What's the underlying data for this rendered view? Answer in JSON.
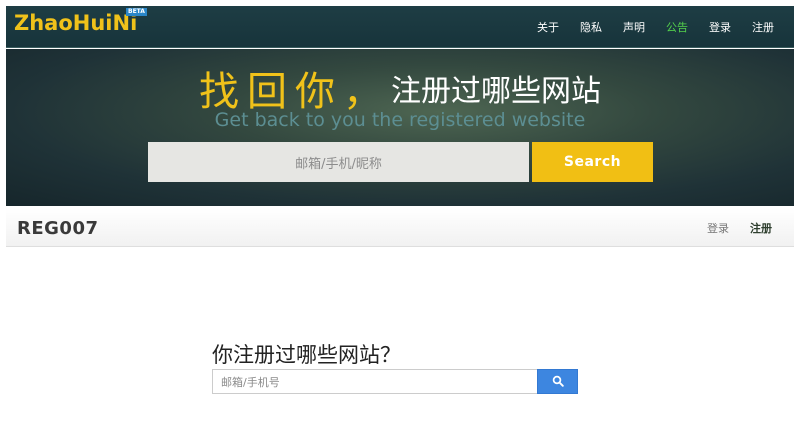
{
  "navbar": {
    "logo": "ZhaoHuiNi",
    "beta": "BETA",
    "items": [
      {
        "label": "关于",
        "active": false
      },
      {
        "label": "隐私",
        "active": false
      },
      {
        "label": "声明",
        "active": false
      },
      {
        "label": "公告",
        "active": true
      },
      {
        "label": "登录",
        "active": false
      },
      {
        "label": "注册",
        "active": false
      }
    ]
  },
  "hero": {
    "title_highlight": "找回你，",
    "title_rest": "注册过哪些网站",
    "subtitle": "Get back to you the registered website",
    "search_placeholder": "邮箱/手机/昵称",
    "search_button": "Search"
  },
  "subheader": {
    "brand": "REG007",
    "login": "登录",
    "register": "注册"
  },
  "main": {
    "question": "你注册过哪些网站？",
    "input_placeholder": "邮箱/手机号",
    "search_icon": "search-icon"
  },
  "colors": {
    "accent_yellow": "#f1bf14",
    "active_green": "#54d24c",
    "button_blue": "#3d86e0"
  }
}
